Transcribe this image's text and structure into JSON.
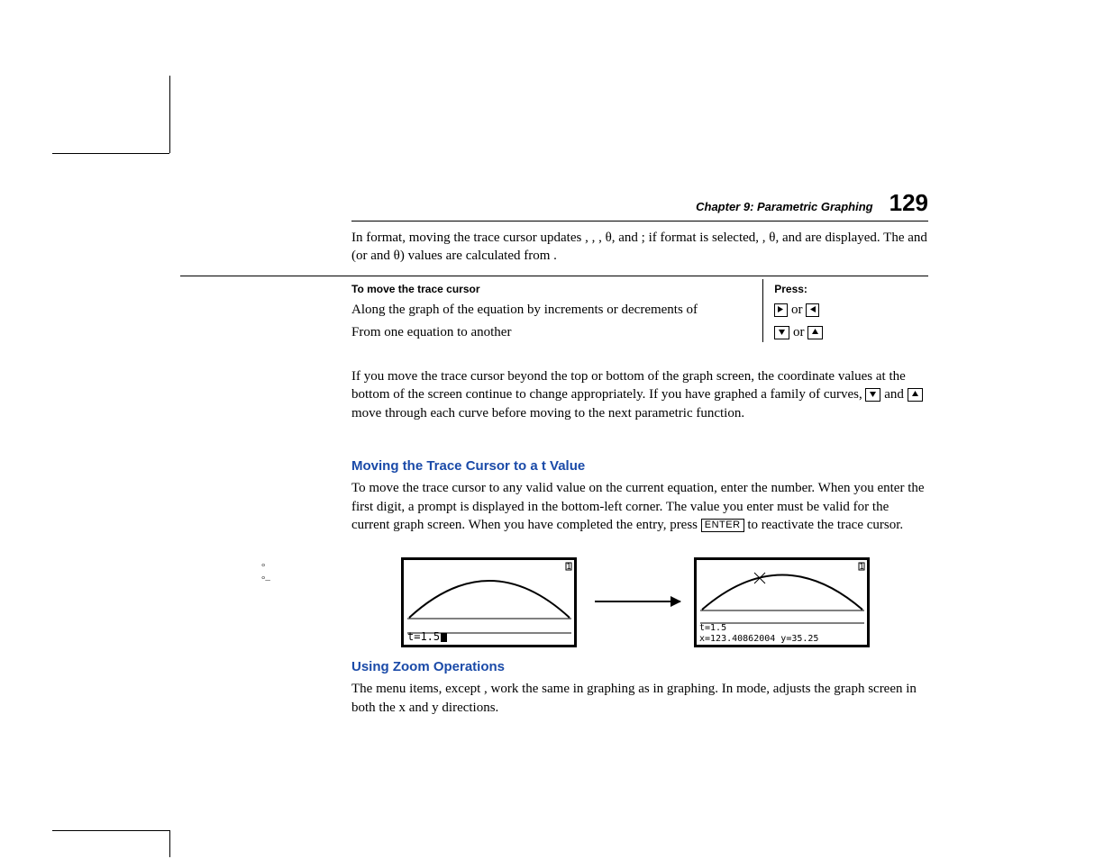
{
  "header": {
    "chapter": "Chapter 9: Parametric Graphing",
    "page": "129"
  },
  "intro": "In          format, moving the trace cursor updates   ,   ,   , θ, and   ; if            format is selected,   , θ, and   are displayed. The    and    (or    and θ) values are calculated from   .",
  "table": {
    "head_move": "To move the trace cursor",
    "head_press": "Press:",
    "rows": [
      {
        "move": "Along the graph of the equation by increments or decrements of ",
        "press_a": "right",
        "press_or": " or ",
        "press_b": "left"
      },
      {
        "move": "From one equation to another",
        "press_a": "down",
        "press_or": " or ",
        "press_b": "up"
      }
    ]
  },
  "para_after_table": "If you move the trace cursor beyond the top or bottom of the graph screen, the coordinate values at the bottom of the screen continue to change appropriately. If you have graphed a family of curves, ",
  "para_after_table_mid": " and ",
  "para_after_table_end": " move through each curve before moving to the next parametric function.",
  "section1": {
    "title": "Moving the Trace Cursor to a t Value",
    "body_a": "To move the trace cursor to any valid    value on the current equation, enter the number. When you enter the first digit, a     prompt is displayed in the bottom-left corner. The value you enter must be valid for the current graph screen. When you have completed the entry, press ",
    "enter": "ENTER",
    "body_b": " to reactivate the trace cursor."
  },
  "screens": {
    "left_status": "t=1.5",
    "right_line1": "t=1.5",
    "right_line2": "x=123.40862004   y=35.25"
  },
  "section2": {
    "title": "Using Zoom Operations",
    "body": "The                  menu items, except        , work the same in          graphing as in          graphing. In          mode,        adjusts the graph screen in both the x and y directions."
  },
  "side": {
    "m1": "°",
    "m2": "°–"
  }
}
